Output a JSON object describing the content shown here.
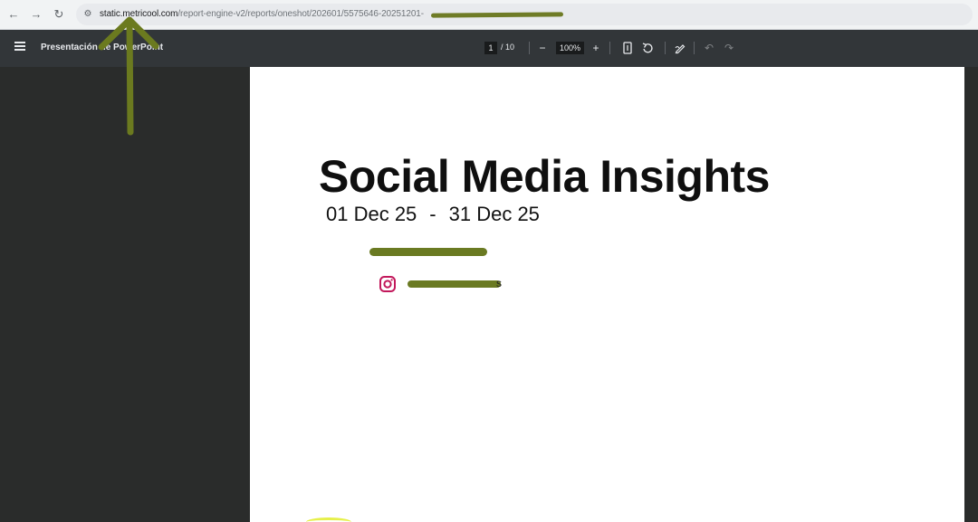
{
  "browser": {
    "back_icon": "arrow-left-icon",
    "forward_icon": "arrow-right-icon",
    "reload_icon": "reload-icon",
    "url_host": "static.metricool.com",
    "url_path": "/report-engine-v2/reports/oneshot/202601/5575646-20251201-"
  },
  "pdf_toolbar": {
    "title": "Presentación de PowerPoint",
    "current_page": "1",
    "total_pages": "/ 10",
    "zoom": "100%",
    "zoom_out": "−",
    "zoom_in": "+"
  },
  "slide": {
    "headline": "Social Media Insights",
    "date_start": "01 Dec 25",
    "date_sep": "-",
    "date_end": "31 Dec 25",
    "handle_tail": "s"
  },
  "colors": {
    "accent_pink": "#f17fd0",
    "accent_yellow": "#e6f54a",
    "annotation": "#6b7a1f",
    "instagram": "#c2185b"
  }
}
